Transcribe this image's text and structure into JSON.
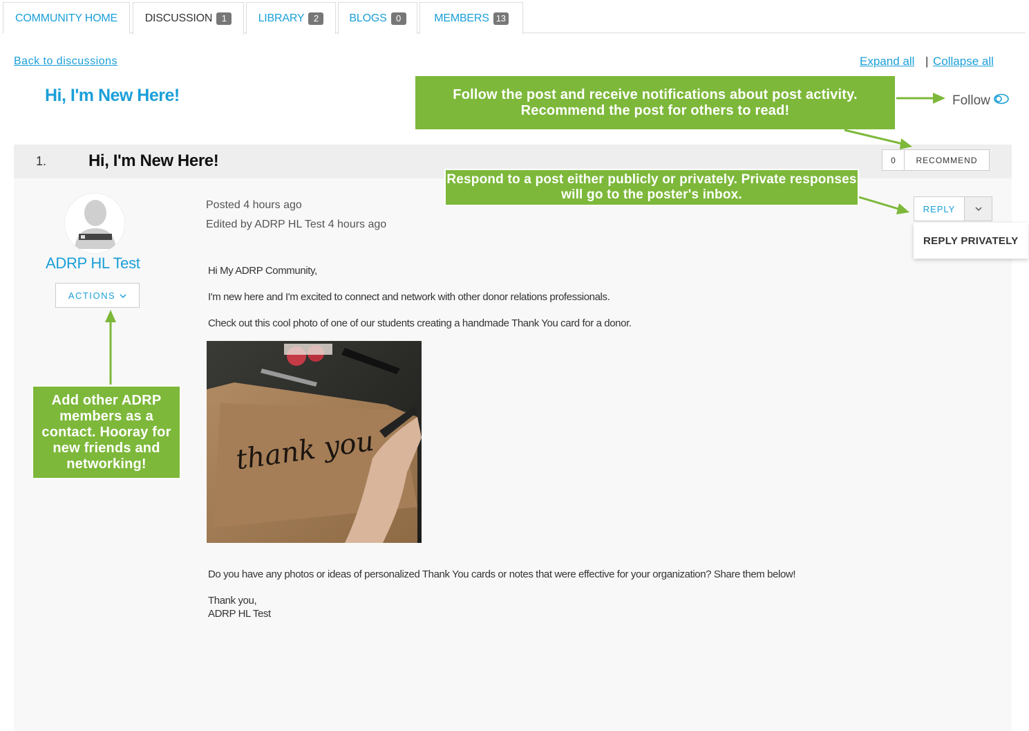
{
  "tabs": [
    {
      "label": "COMMUNITY HOME",
      "badge": ""
    },
    {
      "label": "DISCUSSION",
      "badge": "1"
    },
    {
      "label": "LIBRARY",
      "badge": "2"
    },
    {
      "label": "BLOGS",
      "badge": "0"
    },
    {
      "label": "MEMBERS",
      "badge": "13"
    }
  ],
  "nav": {
    "back": "Back to discussions",
    "expand": "Expand all",
    "separator": "|",
    "collapse": "Collapse all"
  },
  "page_title": "Hi, I'm New Here!",
  "follow_label": "Follow",
  "post": {
    "number": "1.",
    "title": "Hi, I'm New Here!",
    "recommend_count": "0",
    "recommend_label": "RECOMMEND",
    "author": "ADRP HL Test",
    "actions_label": "ACTIONS",
    "posted": "Posted 4 hours ago",
    "edited": "Edited by ADRP HL Test 4 hours ago",
    "reply_label": "REPLY",
    "reply_privately_label": "REPLY PRIVATELY",
    "photo_text": "thank you",
    "body": [
      "Hi My ADRP Community,",
      "I'm new here and I'm excited to connect and network with other donor relations professionals.",
      "Check out this cool photo of one of our students creating a handmade Thank You card for a donor.",
      "Do you have any photos or ideas of personalized Thank You cards or notes that were effective for your organization? Share them below!",
      "Thank you,",
      "ADRP HL Test"
    ]
  },
  "callouts": {
    "follow": "Follow the post and receive notifications about post activity. Recommend the post for others to read!",
    "reply": "Respond to a post either publicly or privately. Private responses will go to the poster's inbox.",
    "contact": "Add other ADRP members as a contact. Hooray for new friends and networking!"
  },
  "colors": {
    "accent": "#1a9fd8",
    "callout": "#7db83a"
  }
}
